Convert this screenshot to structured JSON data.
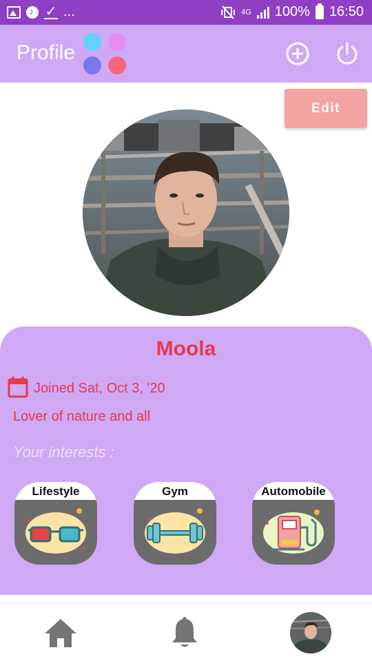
{
  "status_bar": {
    "left_icons": [
      "gallery-icon",
      "music-icon",
      "download-done-icon"
    ],
    "overflow": "...",
    "network": "4G",
    "battery": "100%",
    "time": "16:50"
  },
  "app_bar": {
    "title": "Profile",
    "logo_dot_colors": [
      "#5fd3fb",
      "#e58ef0",
      "#7b76ee",
      "#f7667a"
    ],
    "actions": [
      "add-circle-icon",
      "power-icon"
    ]
  },
  "edit_button": {
    "label": "Edit"
  },
  "profile": {
    "name": "Moola",
    "joined": "Joined Sat, Oct 3, '20",
    "bio": "Lover of nature and all",
    "interests_label": "Your interests :",
    "interests": [
      {
        "label": "Lifestyle",
        "icon": "3d-glasses-icon"
      },
      {
        "label": "Gym",
        "icon": "dumbbell-icon"
      },
      {
        "label": "Automobile",
        "icon": "fuel-pump-icon"
      }
    ]
  },
  "bottom_nav": {
    "items": [
      "home-icon",
      "notifications-icon",
      "profile-avatar"
    ]
  },
  "colors": {
    "status_bar": "#8e3fc4",
    "primary_light": "#d0a9f5",
    "accent_text": "#e53950",
    "edit_button": "#f5a3a3"
  }
}
